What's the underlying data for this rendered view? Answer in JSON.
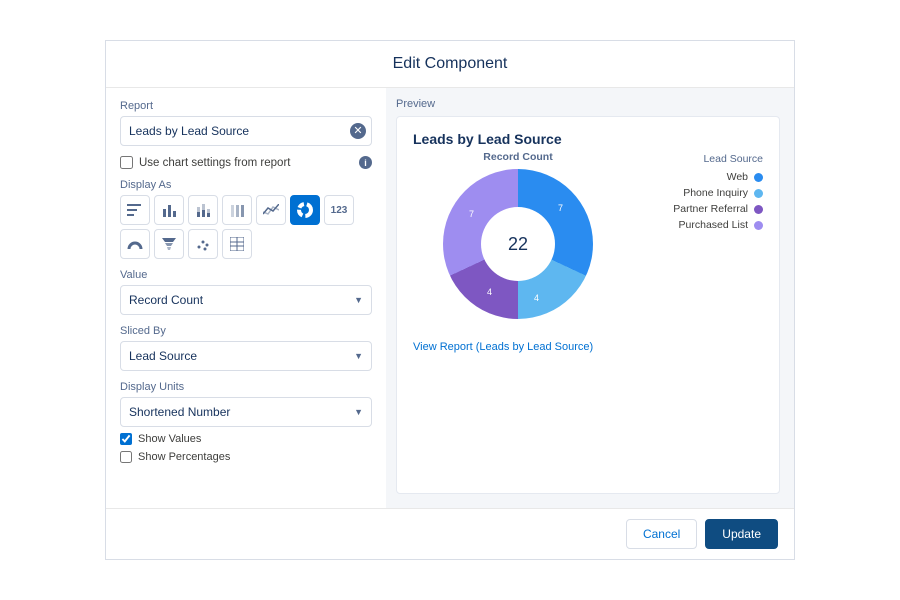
{
  "modal": {
    "title": "Edit Component",
    "footer": {
      "cancel": "Cancel",
      "update": "Update"
    }
  },
  "form": {
    "report_label": "Report",
    "report_value": "Leads by Lead Source",
    "use_chart_settings": "Use chart settings from report",
    "display_as_label": "Display As",
    "icons": [
      "hbar",
      "vbar",
      "stackedvbar",
      "stackedvbar2",
      "line",
      "donut",
      "metric",
      "gauge",
      "funnel",
      "scatter",
      "table"
    ],
    "selected_icon": "donut",
    "value_label": "Value",
    "value_selected": "Record Count",
    "sliced_by_label": "Sliced By",
    "sliced_by_selected": "Lead Source",
    "display_units_label": "Display Units",
    "display_units_selected": "Shortened Number",
    "show_values": "Show Values",
    "show_percentages": "Show Percentages"
  },
  "preview": {
    "section_label": "Preview",
    "title": "Leads by Lead Source",
    "record_count_label": "Record Count",
    "legend_title": "Lead Source",
    "view_report": "View Report (Leads by Lead Source)"
  },
  "chart_data": {
    "type": "pie",
    "title": "Leads by Lead Source",
    "centerLabel": "22",
    "series": [
      {
        "name": "Web",
        "value": 7,
        "color": "#2a8cf0"
      },
      {
        "name": "Phone Inquiry",
        "value": 4,
        "color": "#5eb7f0"
      },
      {
        "name": "Partner Referral",
        "value": 4,
        "color": "#7e57c2"
      },
      {
        "name": "Purchased List",
        "value": 7,
        "color": "#9e8df0"
      }
    ],
    "total": 22
  }
}
